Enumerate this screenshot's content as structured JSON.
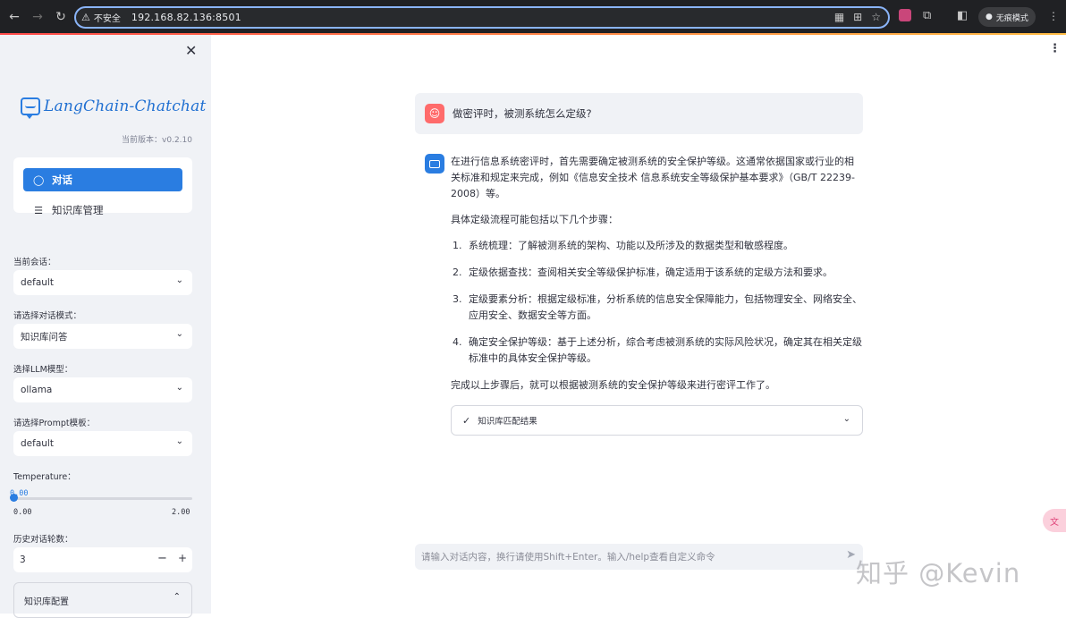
{
  "browser": {
    "insecure_label": "不安全",
    "url": "192.168.82.136:8501",
    "incognito_label": "无痕模式"
  },
  "sidebar": {
    "logo_text": "LangChain-Chatchat",
    "version": "当前版本：v0.2.10",
    "menu": [
      {
        "label": "对话",
        "icon": "chat-bubble-icon",
        "active": true
      },
      {
        "label": "知识库管理",
        "icon": "database-icon",
        "active": false
      }
    ],
    "current_session_label": "当前会话：",
    "current_session_value": "default",
    "chat_mode_label": "请选择对话模式：",
    "chat_mode_value": "知识库问答",
    "llm_label": "选择LLM模型：",
    "llm_value": "ollama",
    "prompt_label": "请选择Prompt模板：",
    "prompt_value": "default",
    "temperature_label": "Temperature：",
    "temperature_value": "0.00",
    "temperature_min": "0.00",
    "temperature_max": "2.00",
    "temperature_fraction": 0.0,
    "history_label": "历史对话轮数：",
    "history_value": "3",
    "kb_config_label": "知识库配置"
  },
  "chat": {
    "user_message": "做密评时，被测系统怎么定级?",
    "answer": {
      "intro": "在进行信息系统密评时，首先需要确定被测系统的安全保护等级。这通常依据国家或行业的相关标准和规定来完成，例如《信息安全技术 信息系统安全等级保护基本要求》（GB/T 22239-2008）等。",
      "steps_intro": "具体定级流程可能包括以下几个步骤：",
      "steps": [
        {
          "num": "1.",
          "text": "系统梳理：了解被测系统的架构、功能以及所涉及的数据类型和敏感程度。"
        },
        {
          "num": "2.",
          "text": "定级依据查找：查阅相关安全等级保护标准，确定适用于该系统的定级方法和要求。"
        },
        {
          "num": "3.",
          "text": "定级要素分析：根据定级标准，分析系统的信息安全保障能力，包括物理安全、网络安全、应用安全、数据安全等方面。"
        },
        {
          "num": "4.",
          "text": "确定安全保护等级：基于上述分析，综合考虑被测系统的实际风险状况，确定其在相关定级标准中的具体安全保护等级。"
        }
      ],
      "conclusion": "完成以上步骤后，就可以根据被测系统的安全保护等级来进行密评工作了。"
    },
    "kb_result_label": "知识库匹配结果",
    "input_placeholder": "请输入对话内容，换行请使用Shift+Enter。输入/help查看自定义命令"
  },
  "watermark": "知乎 @Kevin",
  "colors": {
    "accent": "#2a7de1",
    "user_avatar": "#ff6b6b",
    "sidebar_bg": "#f0f2f6"
  }
}
